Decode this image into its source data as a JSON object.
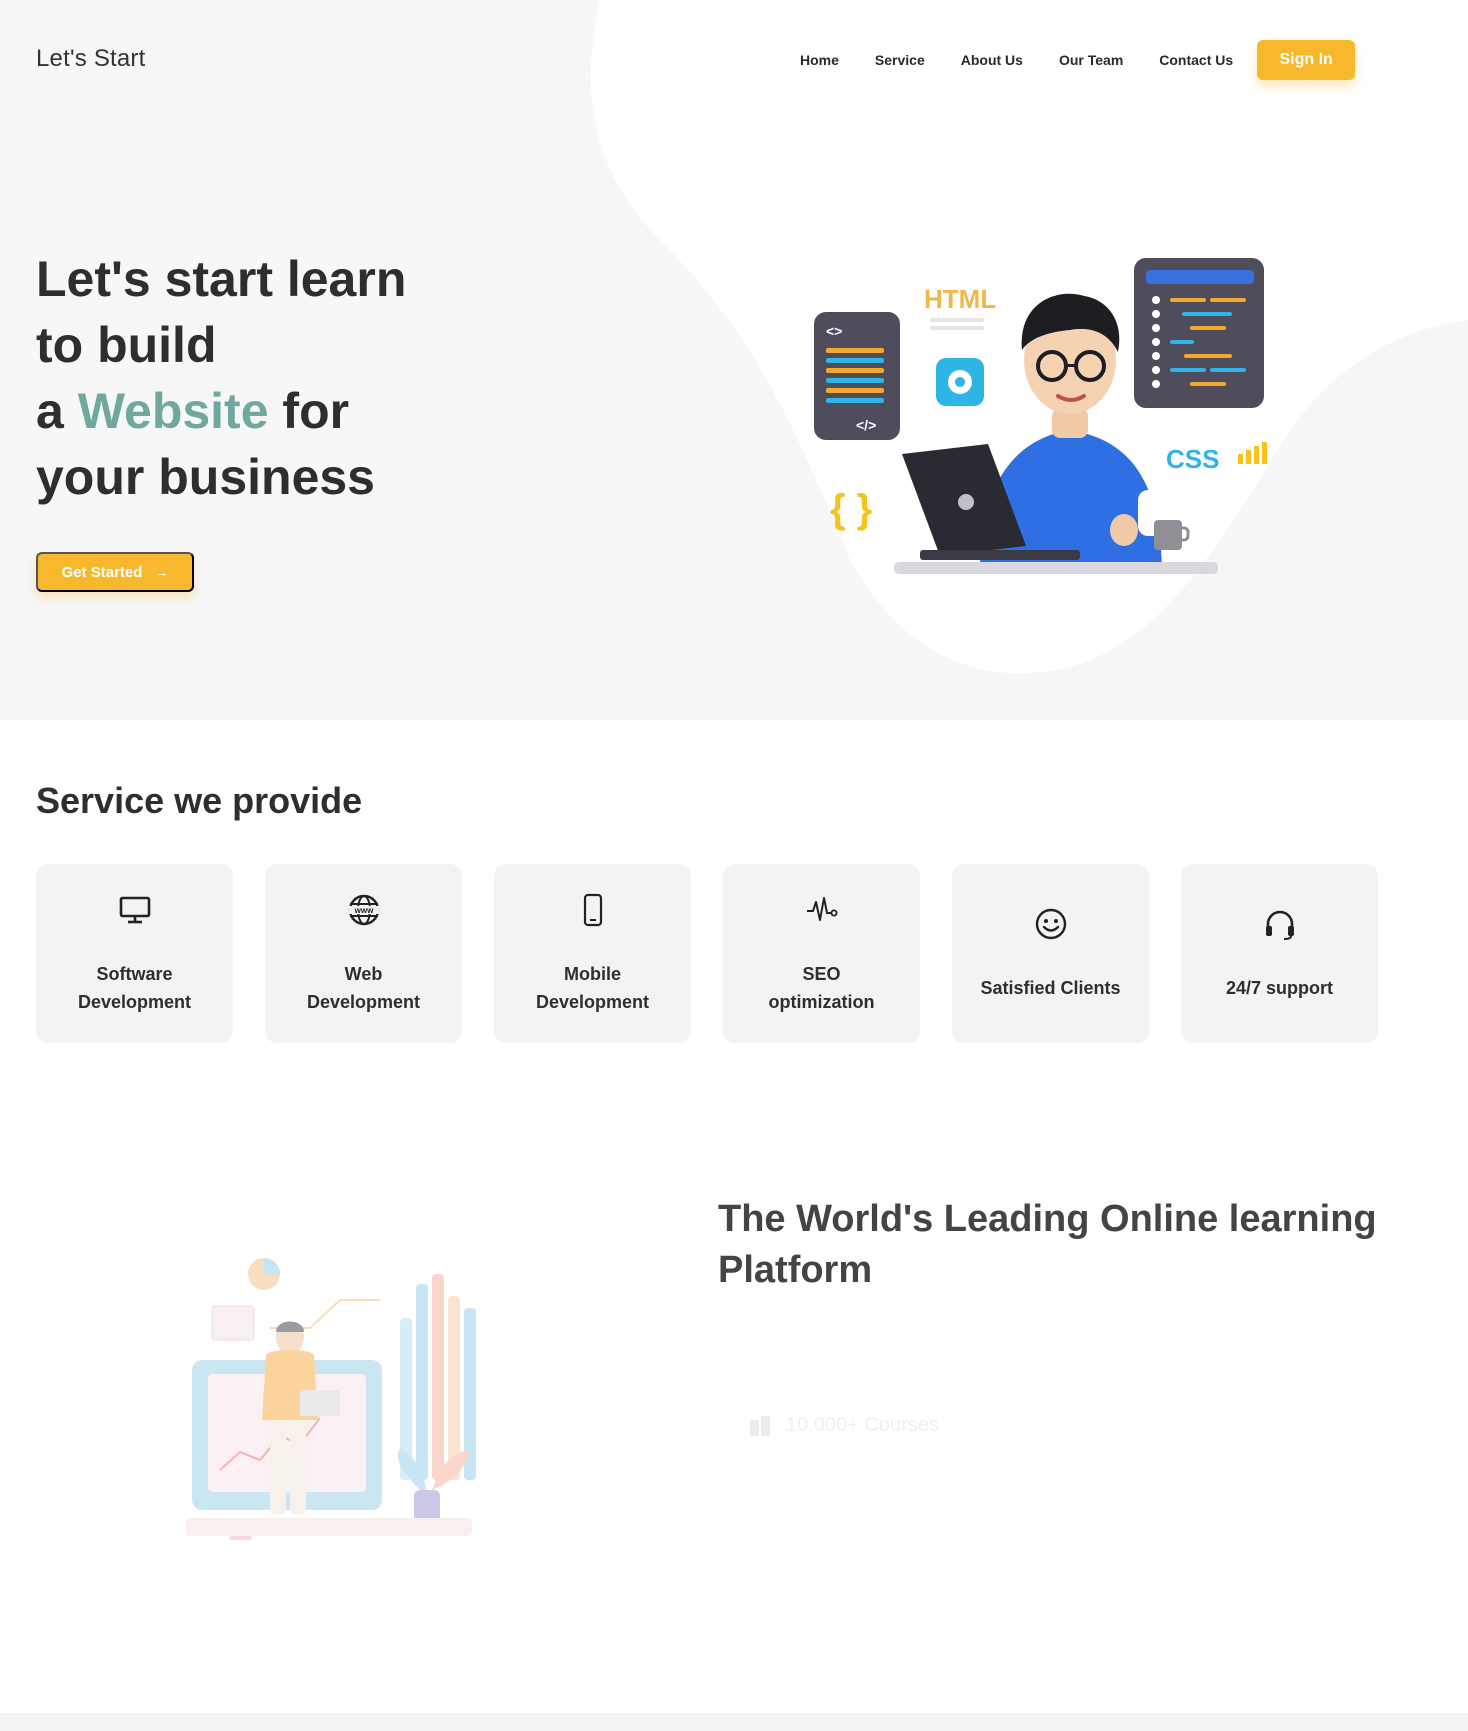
{
  "header": {
    "logo": "Let's Start",
    "nav": [
      "Home",
      "Service",
      "About Us",
      "Our Team",
      "Contact Us"
    ],
    "signin_label": "Sign In"
  },
  "hero": {
    "line1": "Let's start learn",
    "line2": "to build",
    "line3_pre": "a",
    "line3_accent": "Website",
    "line3_post": "for",
    "line4": "your business",
    "cta_label": "Get Started",
    "illustration_text": {
      "html": "HTML",
      "css": "CSS",
      "code_open": "<>",
      "code_close": "</>",
      "braces": "{ }"
    }
  },
  "services": {
    "title": "Service we provide",
    "items": [
      {
        "icon": "monitor-icon",
        "line1": "Software",
        "line2": "Development"
      },
      {
        "icon": "www-globe-icon",
        "line1": "Web",
        "line2": "Development"
      },
      {
        "icon": "mobile-icon",
        "line1": "Mobile",
        "line2": "Development"
      },
      {
        "icon": "pulse-icon",
        "line1": "SEO",
        "line2": "optimization"
      },
      {
        "icon": "smile-icon",
        "line1": "Satisfied Clients"
      },
      {
        "icon": "headset-icon",
        "line1": "24/7 support"
      }
    ]
  },
  "learning": {
    "title_line1": "The World's Leading Online learning",
    "title_line2": "Platform",
    "courses_label": "10,000+ Courses"
  },
  "colors": {
    "accent": "#f7b82e",
    "highlight": "#6fa89e",
    "hero_bg": "#f7f7f7",
    "card_bg": "#f3f3f3"
  }
}
